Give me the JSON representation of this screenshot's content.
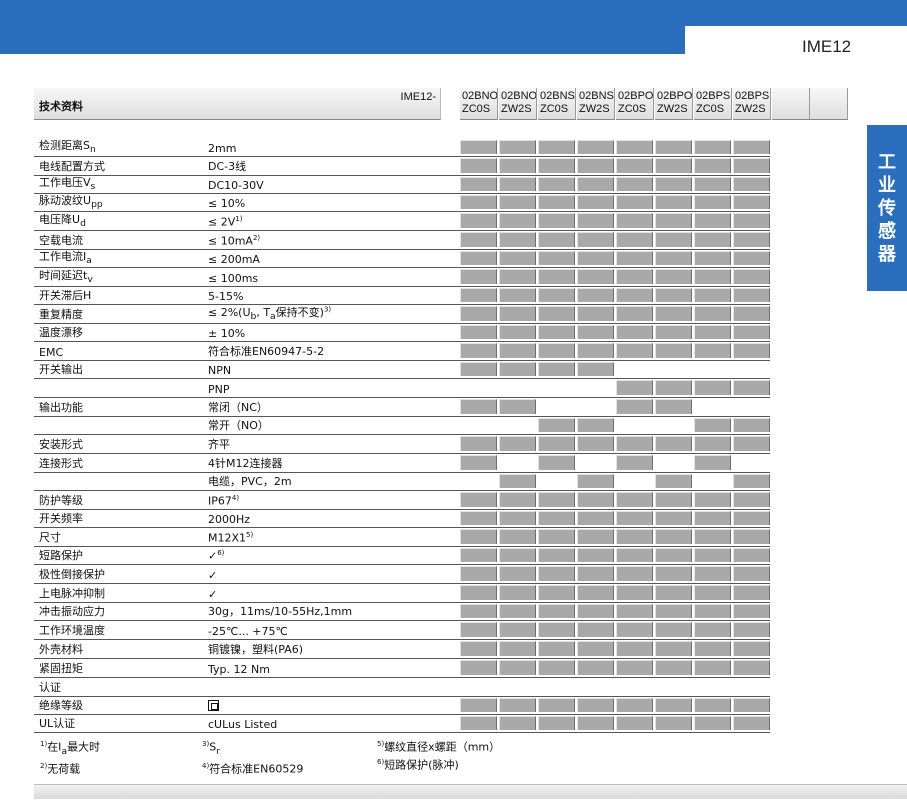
{
  "page": {
    "model": "IME12",
    "side_tab": [
      "工",
      "业",
      "传",
      "感",
      "器"
    ]
  },
  "header": {
    "title": "技术资料",
    "prefix": "IME12-"
  },
  "models": [
    [
      "02BNO",
      "ZC0S"
    ],
    [
      "02BNO",
      "ZW2S"
    ],
    [
      "02BNS",
      "ZC0S"
    ],
    [
      "02BNS",
      "ZW2S"
    ],
    [
      "02BPO",
      "ZC0S"
    ],
    [
      "02BPO",
      "ZW2S"
    ],
    [
      "02BPS",
      "ZC0S"
    ],
    [
      "02BPS",
      "ZW2S"
    ]
  ],
  "rows": [
    {
      "label": "检测距离S",
      "label_sub": "n",
      "value": "2mm",
      "cells": [
        1,
        1,
        1,
        1,
        1,
        1,
        1,
        1
      ]
    },
    {
      "label": "电线配置方式",
      "value": "DC-3线",
      "cells": [
        1,
        1,
        1,
        1,
        1,
        1,
        1,
        1
      ]
    },
    {
      "label": "工作电压V",
      "label_sub": "s",
      "value": "DC10-30V",
      "cells": [
        1,
        1,
        1,
        1,
        1,
        1,
        1,
        1
      ]
    },
    {
      "label": "脉动波纹U",
      "label_sub": "pp",
      "value": "≤ 10%",
      "cells": [
        1,
        1,
        1,
        1,
        1,
        1,
        1,
        1
      ]
    },
    {
      "label": "电压降U",
      "label_sub": "d",
      "value": "≤ 2V",
      "value_sup": "1)",
      "cells": [
        1,
        1,
        1,
        1,
        1,
        1,
        1,
        1
      ]
    },
    {
      "label": "空载电流",
      "value": "≤ 10mA",
      "value_sup": "2)",
      "cells": [
        1,
        1,
        1,
        1,
        1,
        1,
        1,
        1
      ]
    },
    {
      "label": "工作电流I",
      "label_sub": "a",
      "value": "≤ 200mA",
      "cells": [
        1,
        1,
        1,
        1,
        1,
        1,
        1,
        1
      ]
    },
    {
      "label": "时间延迟t",
      "label_sub": "v",
      "value": "≤ 100ms",
      "cells": [
        1,
        1,
        1,
        1,
        1,
        1,
        1,
        1
      ]
    },
    {
      "label": "开关滞后H",
      "value": "5-15%",
      "cells": [
        1,
        1,
        1,
        1,
        1,
        1,
        1,
        1
      ]
    },
    {
      "label": "重复精度",
      "value": "≤ 2%(U",
      "value_sub": "b",
      "value_tail": ",  T",
      "value_sub2": "a",
      "value_tail2": "保持不变)",
      "value_sup": "3)",
      "cells": [
        1,
        1,
        1,
        1,
        1,
        1,
        1,
        1
      ]
    },
    {
      "label": "温度漂移",
      "value": "± 10%",
      "cells": [
        1,
        1,
        1,
        1,
        1,
        1,
        1,
        1
      ]
    },
    {
      "label": "EMC",
      "value": "符合标准EN60947-5-2",
      "cells": [
        1,
        1,
        1,
        1,
        1,
        1,
        1,
        1
      ]
    },
    {
      "label": "开关输出",
      "value": "NPN",
      "cells": [
        1,
        1,
        1,
        1,
        0,
        0,
        0,
        0
      ]
    },
    {
      "label": "",
      "value": "PNP",
      "cells": [
        0,
        0,
        0,
        0,
        1,
        1,
        1,
        1
      ]
    },
    {
      "label": "输出功能",
      "value": "常闭（NC）",
      "cells": [
        1,
        1,
        0,
        0,
        1,
        1,
        0,
        0
      ]
    },
    {
      "label": "",
      "value": "常开（NO）",
      "cells": [
        0,
        0,
        1,
        1,
        0,
        0,
        1,
        1
      ]
    },
    {
      "label": "安装形式",
      "value": "齐平",
      "cells": [
        1,
        1,
        1,
        1,
        1,
        1,
        1,
        1
      ]
    },
    {
      "label": "连接形式",
      "value": "4针M12连接器",
      "cells": [
        1,
        0,
        1,
        0,
        1,
        0,
        1,
        0
      ]
    },
    {
      "label": "",
      "value": "电缆，PVC，2m",
      "cells": [
        0,
        1,
        0,
        1,
        0,
        1,
        0,
        1
      ]
    },
    {
      "label": "防护等级",
      "value": "IP67",
      "value_sup": "4)",
      "cells": [
        1,
        1,
        1,
        1,
        1,
        1,
        1,
        1
      ]
    },
    {
      "label": "开关频率",
      "value": "2000Hz",
      "cells": [
        1,
        1,
        1,
        1,
        1,
        1,
        1,
        1
      ]
    },
    {
      "label": "尺寸",
      "value": "M12X1",
      "value_sup": "5)",
      "cells": [
        1,
        1,
        1,
        1,
        1,
        1,
        1,
        1
      ]
    },
    {
      "label": "短路保护",
      "value": "✓",
      "value_sup": "6)",
      "cells": [
        1,
        1,
        1,
        1,
        1,
        1,
        1,
        1
      ]
    },
    {
      "label": "极性倒接保护",
      "value": "✓",
      "cells": [
        1,
        1,
        1,
        1,
        1,
        1,
        1,
        1
      ]
    },
    {
      "label": "上电脉冲抑制",
      "value": "✓",
      "cells": [
        1,
        1,
        1,
        1,
        1,
        1,
        1,
        1
      ]
    },
    {
      "label": "冲击振动应力",
      "value": "30g，11ms/10-55Hz,1mm",
      "cells": [
        1,
        1,
        1,
        1,
        1,
        1,
        1,
        1
      ]
    },
    {
      "label": "工作环境温度",
      "value": "-25℃... +75℃",
      "cells": [
        1,
        1,
        1,
        1,
        1,
        1,
        1,
        1
      ]
    },
    {
      "label": "外壳材料",
      "value": "铜镀镍，塑料(PA6)",
      "cells": [
        1,
        1,
        1,
        1,
        1,
        1,
        1,
        1
      ]
    },
    {
      "label": "紧固扭矩",
      "value": "Typ. 12 Nm",
      "cells": [
        1,
        1,
        1,
        1,
        1,
        1,
        1,
        1
      ]
    },
    {
      "label": "认证",
      "value": "",
      "cells": [
        0,
        0,
        0,
        0,
        0,
        0,
        0,
        0
      ]
    },
    {
      "label": "绝缘等级",
      "value": "",
      "value_icon": "double-square-icon",
      "cells": [
        1,
        1,
        1,
        1,
        1,
        1,
        1,
        1
      ]
    },
    {
      "label": "UL认证",
      "value": "cULus Listed",
      "cells": [
        1,
        1,
        1,
        1,
        1,
        1,
        1,
        1
      ]
    }
  ],
  "footnotes": {
    "col1": [
      {
        "num": "1)",
        "text": "在I",
        "sub": "a",
        "tail": "最大时"
      },
      {
        "num": "2)",
        "text": "无荷载"
      }
    ],
    "col2": [
      {
        "num": "3)",
        "text": "S",
        "sub": "r"
      },
      {
        "num": "4)",
        "text": "符合标准EN60529"
      }
    ],
    "col3": [
      {
        "num": "5)",
        "text": "螺纹直径x螺距（mm）"
      },
      {
        "num": "6)",
        "text": "短路保护(脉冲)"
      }
    ]
  },
  "colors": {
    "brand_blue": "#2a6fbe",
    "cell_gray": "#a9a9a9"
  }
}
